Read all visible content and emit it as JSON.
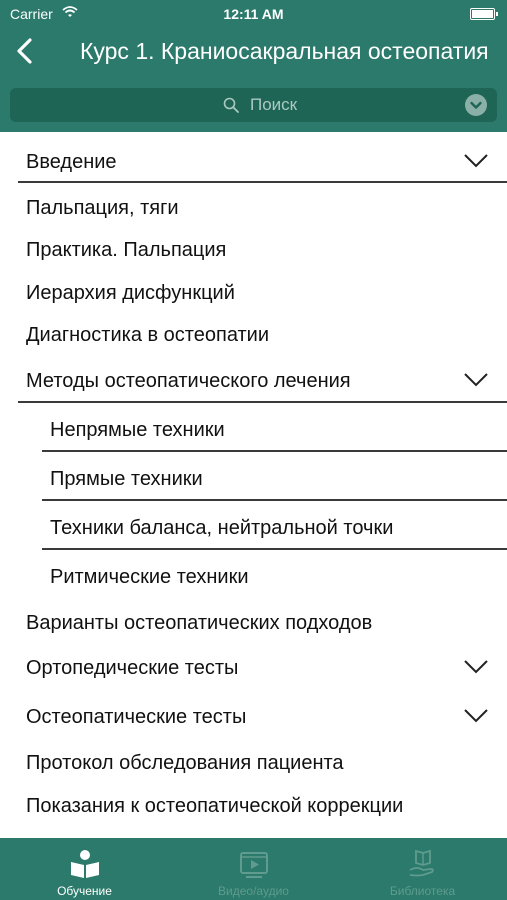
{
  "status_bar": {
    "carrier": "Carrier",
    "time": "12:11 AM"
  },
  "nav": {
    "title": "Курс 1. Краниосакральная остеопатия"
  },
  "search": {
    "placeholder": "Поиск"
  },
  "colors": {
    "accent": "#2b7a6b",
    "search_bg": "#1f6556",
    "text": "#111111",
    "tab_inactive": "#5f9b8e"
  },
  "list": {
    "items": [
      {
        "label": "Введение",
        "level": 0,
        "expandable": true
      },
      {
        "label": "Пальпация, тяги",
        "level": 0,
        "expandable": false
      },
      {
        "label": "Практика. Пальпация",
        "level": 0,
        "expandable": false
      },
      {
        "label": "Иерархия дисфункций",
        "level": 0,
        "expandable": false
      },
      {
        "label": "Диагностика в остеопатии",
        "level": 0,
        "expandable": false
      },
      {
        "label": "Методы остеопатического лечения",
        "level": 0,
        "expandable": true
      },
      {
        "label": "Непрямые техники",
        "level": 1,
        "expandable": false
      },
      {
        "label": "Прямые техники",
        "level": 1,
        "expandable": false
      },
      {
        "label": "Техники баланса, нейтральной точки",
        "level": 1,
        "expandable": false
      },
      {
        "label": "Ритмические техники",
        "level": 1,
        "expandable": false
      },
      {
        "label": "Варианты остеопатических подходов",
        "level": 0,
        "expandable": false
      },
      {
        "label": "Ортопедические тесты",
        "level": 0,
        "expandable": true
      },
      {
        "label": "Остеопатические тесты",
        "level": 0,
        "expandable": true
      },
      {
        "label": "Протокол обследования пациента",
        "level": 0,
        "expandable": false
      },
      {
        "label": "Показания к остеопатической коррекции",
        "level": 0,
        "expandable": false
      }
    ]
  },
  "tabbar": {
    "tabs": [
      {
        "label": "Обучение",
        "icon": "reader-book-icon",
        "active": true
      },
      {
        "label": "Видео/аудио",
        "icon": "video-player-icon",
        "active": false
      },
      {
        "label": "Библиотека",
        "icon": "hand-book-icon",
        "active": false
      }
    ]
  }
}
